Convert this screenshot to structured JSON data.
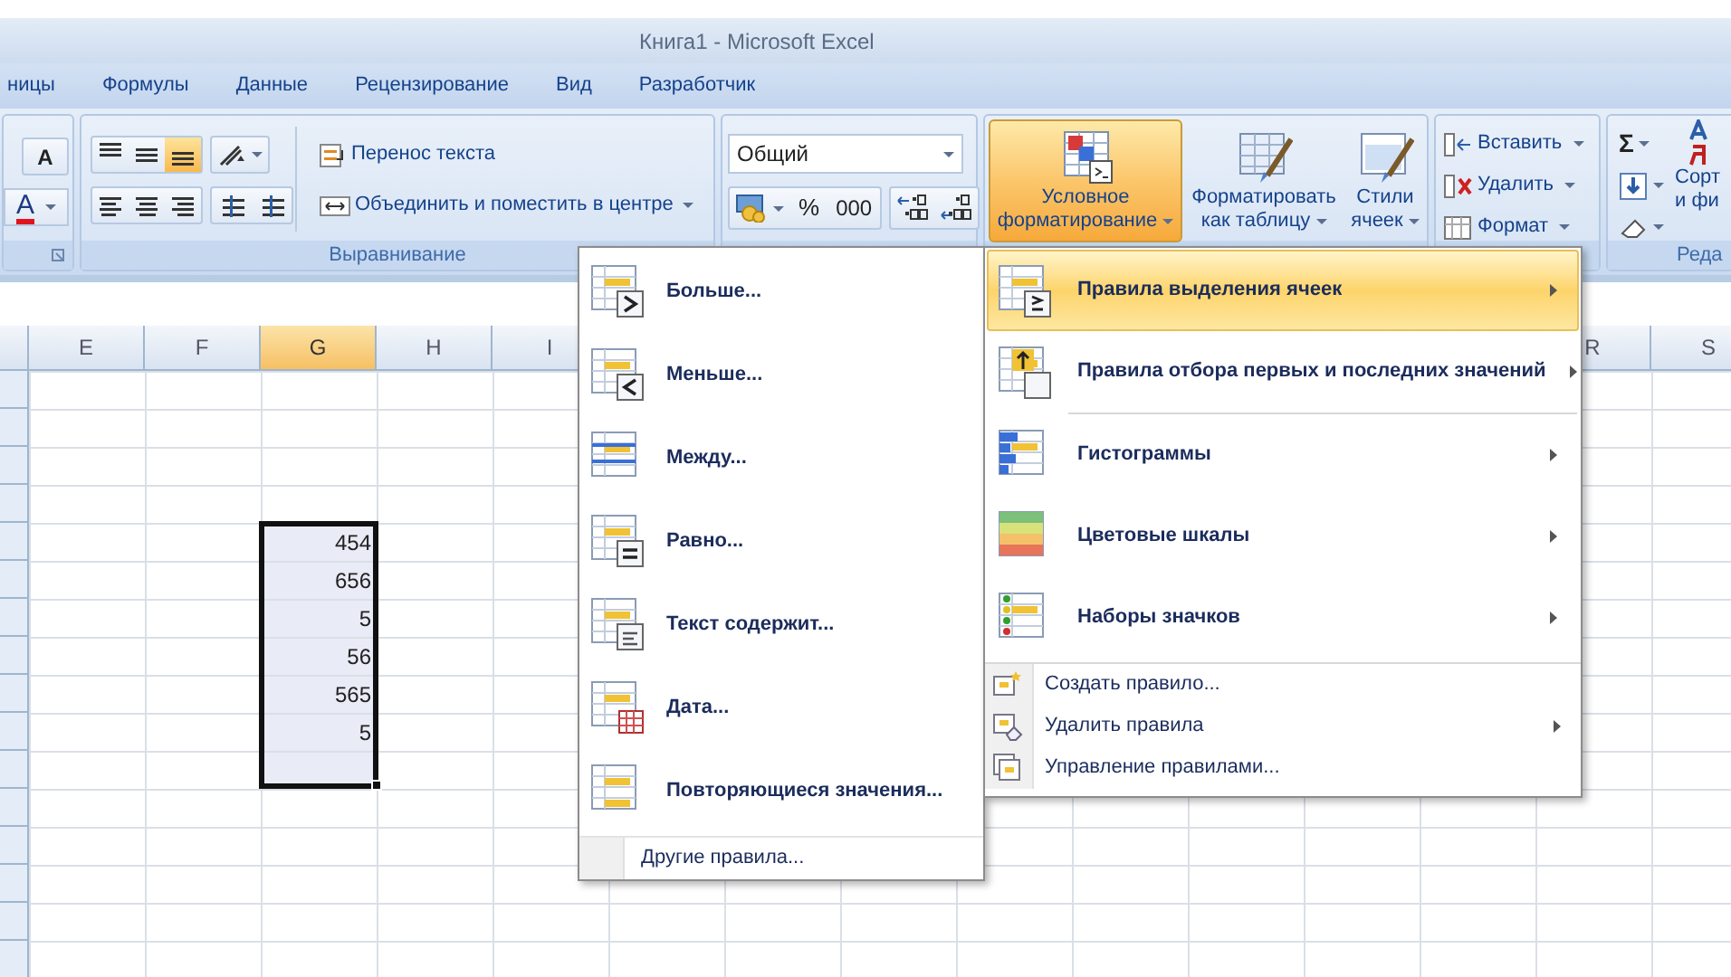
{
  "window": {
    "title": "Книга1 - Microsoft Excel"
  },
  "tabs": [
    {
      "label": "ницы",
      "selected": false
    },
    {
      "label": "Формулы",
      "selected": false
    },
    {
      "label": "Данные",
      "selected": false
    },
    {
      "label": "Рецензирование",
      "selected": false
    },
    {
      "label": "Вид",
      "selected": false
    },
    {
      "label": "Разработчик",
      "selected": false
    }
  ],
  "ribbon": {
    "font_group": {
      "grow_font": "A",
      "font_color": "A"
    },
    "alignment_group": {
      "label": "Выравнивание",
      "vertical_align": [
        {
          "selected": false
        },
        {
          "selected": false
        },
        {
          "selected": true
        }
      ],
      "wrap_text": "Перенос текста",
      "merge": "Объединить и поместить в центре"
    },
    "number_group": {
      "format": "Общий",
      "percent": "%",
      "thousands": "000"
    },
    "styles_group": {
      "buttons": [
        {
          "label_lines": [
            "Условное",
            "форматирование"
          ],
          "pressed": true
        },
        {
          "label_lines": [
            "Форматировать",
            "как таблицу"
          ],
          "pressed": false
        },
        {
          "label_lines": [
            "Стили",
            "ячеек"
          ],
          "pressed": false
        }
      ]
    },
    "cells_group": {
      "buttons": [
        "Вставить",
        "Удалить",
        "Формат"
      ]
    },
    "editing_group": {
      "label": "Реда",
      "autosum": "Σ",
      "sort_lines": [
        "Сорт",
        "и фи"
      ]
    }
  },
  "sheet": {
    "columns_left": [
      {
        "label": "E",
        "selected": false
      },
      {
        "label": "F",
        "selected": false
      },
      {
        "label": "G",
        "selected": true
      },
      {
        "label": "H",
        "selected": false
      },
      {
        "label": "I",
        "selected": false
      }
    ],
    "columns_right": [
      {
        "label": "R",
        "selected": false
      },
      {
        "label": "S",
        "selected": false
      }
    ],
    "selection_values": [
      "454",
      "656",
      "5",
      "56",
      "565",
      "5"
    ]
  },
  "rules_submenu": {
    "items": [
      {
        "label": "Больше..."
      },
      {
        "label": "Меньше..."
      },
      {
        "label": "Между..."
      },
      {
        "label": "Равно..."
      },
      {
        "label": "Текст содержит..."
      },
      {
        "label": "Дата..."
      },
      {
        "label": "Повторяющиеся значения..."
      }
    ],
    "footer": "Другие правила..."
  },
  "conditional_menu": {
    "items": [
      {
        "label": "Правила выделения ячеек",
        "selected": true,
        "has_submenu": true
      },
      {
        "label": "Правила отбора первых и последних значений",
        "selected": false,
        "has_submenu": true
      },
      {
        "label": "Гистограммы",
        "selected": false,
        "has_submenu": true
      },
      {
        "label": "Цветовые шкалы",
        "selected": false,
        "has_submenu": true
      },
      {
        "label": "Наборы значков",
        "selected": false,
        "has_submenu": true
      }
    ],
    "commands": [
      {
        "label": "Создать правило...",
        "has_submenu": false
      },
      {
        "label": "Удалить правила",
        "has_submenu": true
      },
      {
        "label": "Управление правилами...",
        "has_submenu": false
      }
    ]
  }
}
